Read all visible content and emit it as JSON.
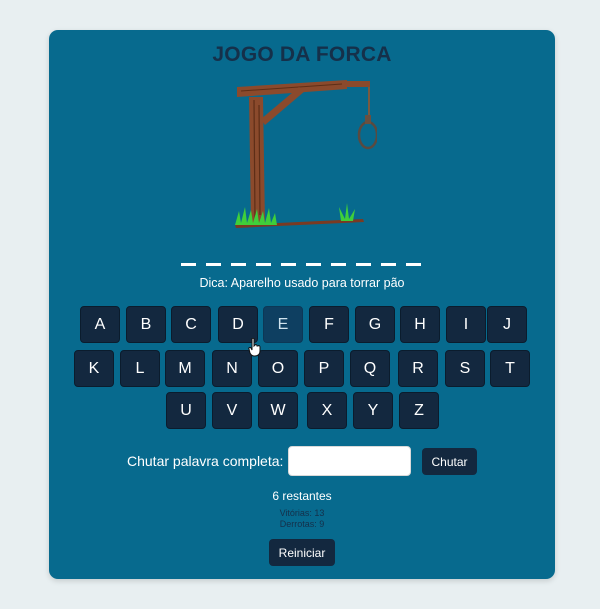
{
  "game": {
    "title": "JOGO DA FORCA",
    "word_slots": 10,
    "hint": "Dica: Aparelho usado para torrar pão"
  },
  "keyboard": {
    "rows": [
      [
        "A",
        "B",
        "C",
        "D",
        "E",
        "F",
        "G",
        "H",
        "I",
        "J"
      ],
      [
        "K",
        "L",
        "M",
        "N",
        "O",
        "P",
        "Q",
        "R",
        "S",
        "T"
      ],
      [
        "U",
        "V",
        "W",
        "X",
        "Y",
        "Z"
      ]
    ],
    "used": [
      "E"
    ]
  },
  "guess": {
    "label": "Chutar palavra completa:",
    "value": "",
    "placeholder": "",
    "button": "Chutar"
  },
  "status": {
    "remaining": "6 restantes",
    "wins": "Vitórias: 13",
    "losses": "Derrotas: 9"
  },
  "restart": "Reiniciar",
  "colors": {
    "page_bg": "#e8eff1",
    "card_bg": "#076a8e",
    "key_bg": "#13283f",
    "title": "#15304a"
  },
  "icons": [
    "gallows-drawing",
    "pointer-cursor-icon"
  ]
}
